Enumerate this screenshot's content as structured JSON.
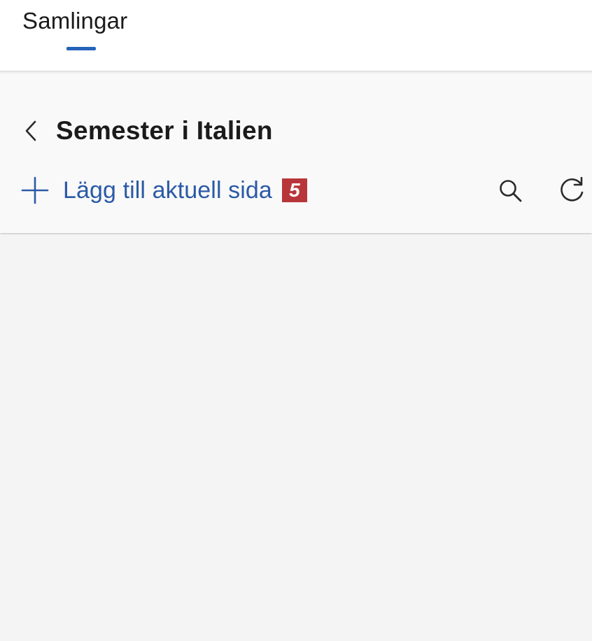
{
  "header": {
    "tab_label": "Samlingar"
  },
  "collection": {
    "title": "Semester i Italien",
    "add_label": "Lägg till aktuell sida",
    "badge": "5"
  },
  "icons": {
    "back": "chevron-left-icon",
    "add": "plus-icon",
    "search": "search-icon",
    "refresh": "refresh-icon"
  },
  "colors": {
    "accent": "#2463b9",
    "link": "#2b5aa6",
    "badge": "#b8363a"
  }
}
